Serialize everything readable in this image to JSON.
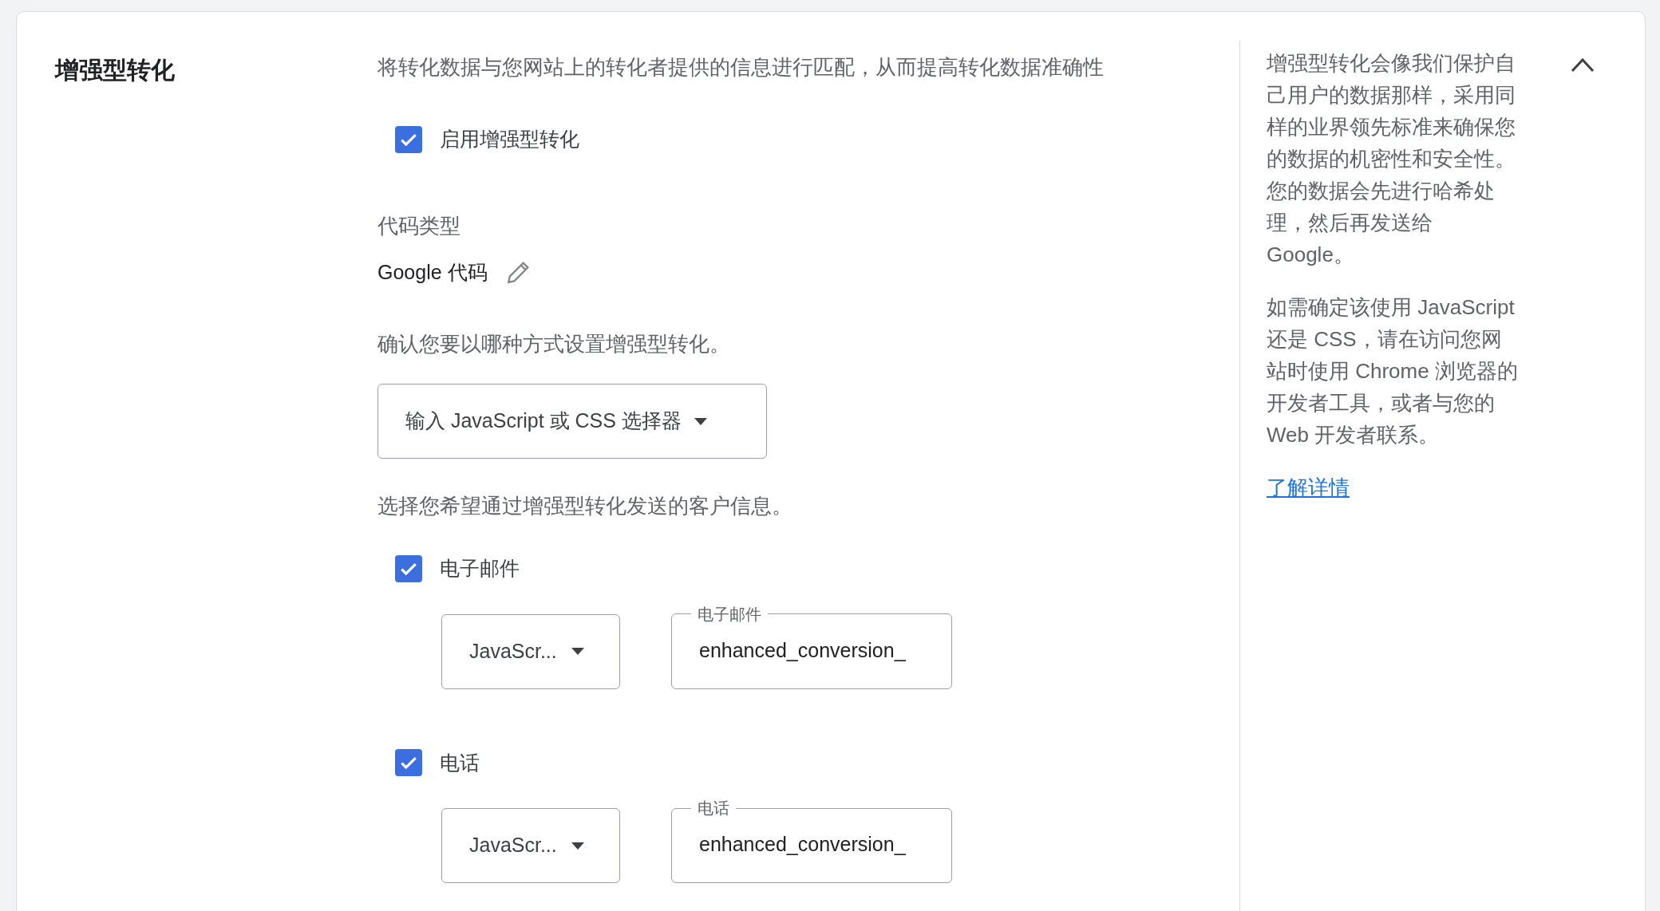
{
  "section": {
    "title": "增强型转化",
    "description": "将转化数据与您网站上的转化者提供的信息进行匹配，从而提高转化数据准确性",
    "expanded": true
  },
  "enable": {
    "label": "启用增强型转化",
    "checked": true
  },
  "code_type": {
    "label": "代码类型",
    "value": "Google 代码"
  },
  "method": {
    "prompt": "确认您要以哪种方式设置增强型转化。",
    "dropdown": "输入 JavaScript 或 CSS 选择器"
  },
  "customer_info": {
    "prompt": "选择您希望通过增强型转化发送的客户信息。",
    "items": [
      {
        "label": "电子邮件",
        "checked": true,
        "dropdown": "JavaScr...",
        "field_label": "电子邮件",
        "field_value": "enhanced_conversion_"
      },
      {
        "label": "电话",
        "checked": true,
        "dropdown": "JavaScr...",
        "field_label": "电话",
        "field_value": "enhanced_conversion_"
      }
    ]
  },
  "help": {
    "paragraphs": [
      "增强型转化会像我们保护自己用户的数据那样，采用同样的业界领先标准来确保您的数据的机密性和安全性。您的数据会先进行哈希处理，然后再发送给 Google。",
      "如需确定该使用 JavaScript 还是 CSS，请在访问您网站时使用 Chrome 浏览器的开发者工具，或者与您的 Web 开发者联系。"
    ],
    "link": "了解详情"
  }
}
